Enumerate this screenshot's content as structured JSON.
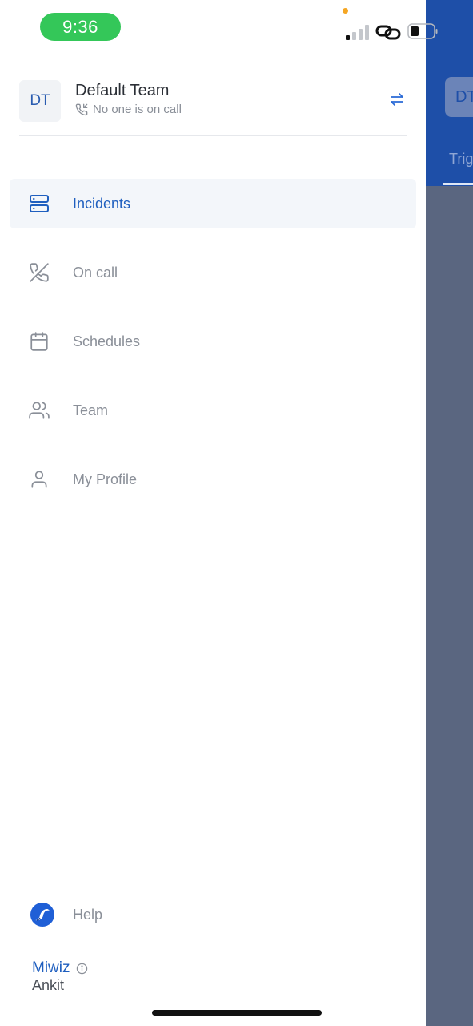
{
  "status_bar": {
    "time": "9:36"
  },
  "background_app": {
    "team_initials": "DT",
    "tab_partial": "Trig"
  },
  "team": {
    "initials": "DT",
    "name": "Default Team",
    "on_call_status": "No one is on call"
  },
  "menu": {
    "items": [
      {
        "label": "Incidents",
        "icon": "server-icon",
        "active": true
      },
      {
        "label": "On call",
        "icon": "phone-off-icon",
        "active": false
      },
      {
        "label": "Schedules",
        "icon": "calendar-icon",
        "active": false
      },
      {
        "label": "Team",
        "icon": "users-icon",
        "active": false
      },
      {
        "label": "My Profile",
        "icon": "user-icon",
        "active": false
      }
    ]
  },
  "footer": {
    "help_label": "Help",
    "org_name": "Miwiz",
    "user_name": "Ankit"
  },
  "colors": {
    "accent": "#1f5fbf",
    "active_bg": "#f3f6fa",
    "status_green": "#34c759",
    "overlay": "#5a6680",
    "bg_header": "#1e4fa8"
  }
}
